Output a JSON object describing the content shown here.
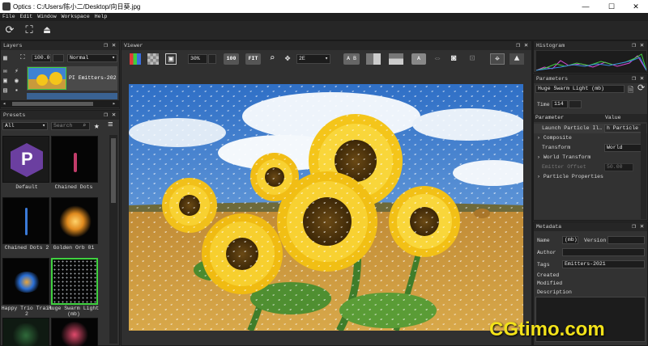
{
  "window": {
    "title": "Optics : C:/Users/陈小二/Desktop/向日葵.jpg",
    "minimize": "—",
    "maximize": "☐",
    "close": "✕"
  },
  "menu": [
    "File",
    "Edit",
    "Window",
    "Workspace",
    "Help"
  ],
  "layers": {
    "title": "Layers",
    "opacity": "100.00",
    "blend_mode": "Normal",
    "layer_name": "PI Emitters-202"
  },
  "presets": {
    "title": "Presets",
    "filter": "All",
    "search_placeholder": "Search",
    "items": [
      {
        "label": "Default"
      },
      {
        "label": "Chained Dots"
      },
      {
        "label": "Chained Dots 2"
      },
      {
        "label": "Golden Orb 01"
      },
      {
        "label": "Happy Trio Trail 2"
      },
      {
        "label": "Huge Swarm Light (mb)"
      }
    ]
  },
  "viewer": {
    "title": "Viewer",
    "zoom": "30%",
    "btn_100": "100",
    "btn_fit": "FIT",
    "view_mode": "2E",
    "ab_a": "A",
    "ab_b": "B",
    "a_label": "A"
  },
  "histogram": {
    "title": "Histogram"
  },
  "parameters": {
    "title": "Parameters",
    "preset_name": "Huge Swarm Light (mb)",
    "time_label": "Time",
    "time_value": "114",
    "col_parameter": "Parameter",
    "col_value": "Value",
    "rows": [
      {
        "name": "Launch Particle Il…",
        "value": "h Particle Illu"
      },
      {
        "name": "Composite",
        "value": ""
      },
      {
        "name": "Transform",
        "value": "World"
      },
      {
        "name": "World Transform",
        "value": ""
      },
      {
        "name": "Emitter Offset",
        "value": "50.00"
      },
      {
        "name": "Particle Properties",
        "value": ""
      }
    ]
  },
  "metadata": {
    "title": "Metadata",
    "name_label": "Name",
    "name_value": "(mb)",
    "version_label": "Version",
    "author_label": "Author",
    "tags_label": "Tags",
    "tags_value": "Emitters-2021",
    "created_label": "Created",
    "modified_label": "Modified",
    "description_label": "Description"
  },
  "watermark": "CGtimo.com",
  "colors": {
    "bg": "#2b2b2b",
    "panel": "#323232",
    "accent_green": "#3fd13f",
    "sky": "#3f82d2",
    "sunflower": "#f4c51a"
  }
}
